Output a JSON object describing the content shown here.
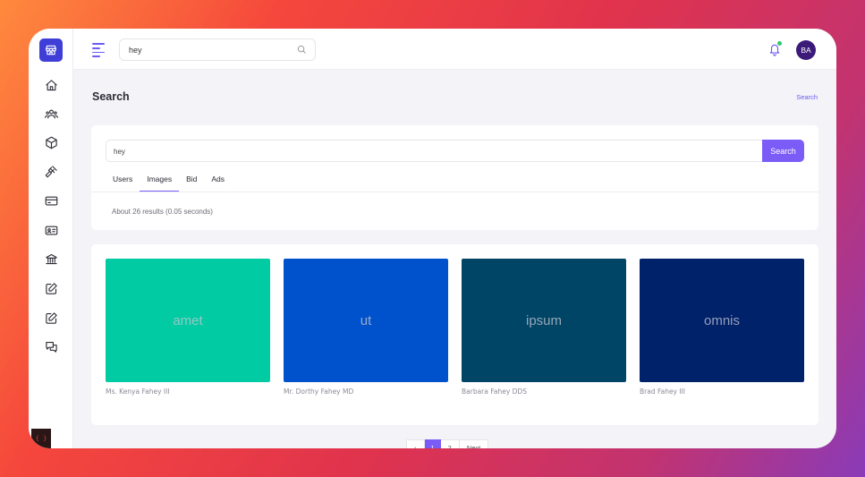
{
  "colors": {
    "accent": "#7c5cf6",
    "logo_bg": "#3f3fd8",
    "status_online": "#2ecc71"
  },
  "topbar": {
    "search_value": "hey",
    "avatar_initials": "BA"
  },
  "page": {
    "title": "Search",
    "breadcrumb": "Search"
  },
  "search": {
    "query": "hey",
    "button_label": "Search",
    "tabs": [
      {
        "label": "Users",
        "active": false
      },
      {
        "label": "Images",
        "active": true
      },
      {
        "label": "Bid",
        "active": false
      },
      {
        "label": "Ads",
        "active": false
      }
    ],
    "results_info": "About 26 results (0.05 seconds)"
  },
  "images": [
    {
      "word": "amet",
      "author": "Ms. Kenya Fahey III",
      "color": "#00cba3"
    },
    {
      "word": "ut",
      "author": "Mr. Dorthy Fahey MD",
      "color": "#0052cc"
    },
    {
      "word": "ipsum",
      "author": "Barbara Fahey DDS",
      "color": "#004466"
    },
    {
      "word": "omnis",
      "author": "Brad Fahey III",
      "color": "#00226b"
    }
  ],
  "pagination": {
    "prev": "‹",
    "pages": [
      "1",
      "2"
    ],
    "next": "Next"
  },
  "sidebar_icons": [
    "home-icon",
    "users-icon",
    "box-icon",
    "gavel-icon",
    "credit-card-icon",
    "id-card-icon",
    "bank-icon",
    "edit-icon",
    "edit-alt-icon",
    "chat-icon"
  ]
}
